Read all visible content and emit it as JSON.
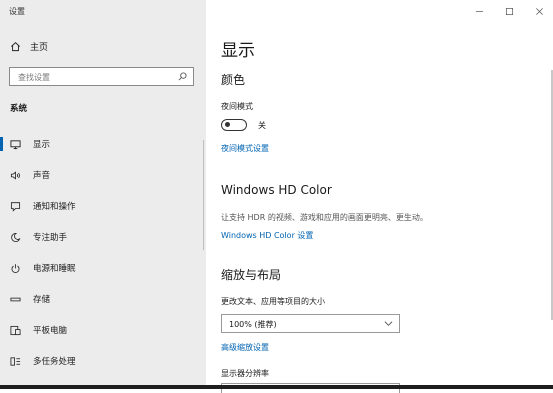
{
  "app": {
    "title": "设置"
  },
  "sidebar": {
    "home_label": "主页",
    "search_placeholder": "查找设置",
    "section_title": "系统",
    "items": [
      {
        "label": "显示",
        "icon": "monitor-icon",
        "active": true
      },
      {
        "label": "声音",
        "icon": "speaker-icon"
      },
      {
        "label": "通知和操作",
        "icon": "notification-icon"
      },
      {
        "label": "专注助手",
        "icon": "moon-icon"
      },
      {
        "label": "电源和睡眠",
        "icon": "power-icon"
      },
      {
        "label": "存储",
        "icon": "storage-icon"
      },
      {
        "label": "平板电脑",
        "icon": "tablet-icon"
      },
      {
        "label": "多任务处理",
        "icon": "multitask-icon"
      }
    ]
  },
  "main": {
    "page_title": "显示",
    "color": {
      "heading": "颜色",
      "night_light_label": "夜间模式",
      "night_light_state": "关",
      "night_light_link": "夜间模式设置"
    },
    "hdr": {
      "heading": "Windows HD Color",
      "description": "让支持 HDR 的视频、游戏和应用的画面更明亮、更生动。",
      "link": "Windows HD Color 设置"
    },
    "scale": {
      "heading": "缩放与布局",
      "text_size_label": "更改文本、应用等项目的大小",
      "text_size_value": "100% (推荐)",
      "advanced_link": "高级缩放设置",
      "resolution_label": "显示器分辨率"
    }
  },
  "colors": {
    "accent": "#0063b1",
    "sidebar_bg": "#ececec"
  }
}
